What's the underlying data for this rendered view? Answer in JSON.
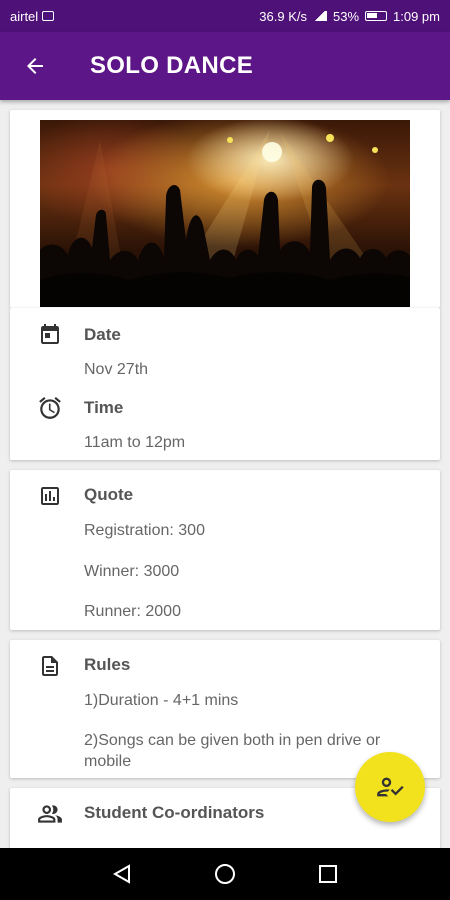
{
  "status_bar": {
    "carrier": "airtel",
    "speed": "36.9 K/s",
    "battery": "53%",
    "time": "1:09 pm"
  },
  "app_bar": {
    "title": "SOLO DANCE",
    "back_icon": "arrow-back-icon"
  },
  "hero_image": {
    "description_icon": "concert-crowd-image"
  },
  "schedule": {
    "date_label": "Date",
    "date_value": "Nov 27th",
    "time_label": "Time",
    "time_value": "11am to 12pm"
  },
  "quote": {
    "label": "Quote",
    "registration": "Registration: 300",
    "winner": "Winner: 3000",
    "runner": "Runner: 2000"
  },
  "rules": {
    "label": "Rules",
    "items": [
      "1)Duration - 4+1 mins",
      "2)Songs can be given both in pen drive or mobile"
    ]
  },
  "coordinators": {
    "label": "Student Co-ordinators"
  },
  "fab": {
    "icon": "person-check-icon",
    "color": "#f2e21e"
  },
  "colors": {
    "primary": "#5d1687",
    "status_bar": "#4e1178"
  }
}
